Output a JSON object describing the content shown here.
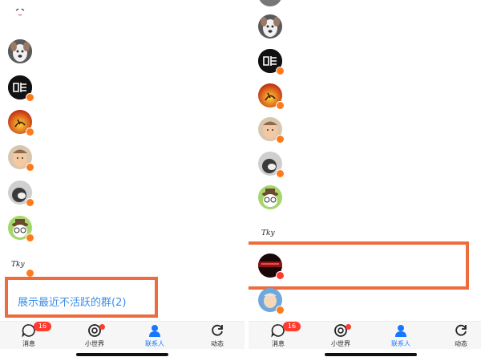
{
  "left_panel": {
    "inactive_groups_link": "展示最近不活跃的群(2)"
  },
  "tabs": [
    {
      "label": "消息",
      "badge": "16",
      "icon": "message-icon"
    },
    {
      "label": "小世界",
      "dot": true,
      "icon": "small-world-icon"
    },
    {
      "label": "联系人",
      "active": true,
      "icon": "contacts-icon"
    },
    {
      "label": "动态",
      "icon": "refresh-icon"
    }
  ],
  "colors": {
    "highlight": "#ed6c3e",
    "accent_blue": "#1677ff",
    "badge_red": "#ff3b30",
    "online_badge": "#ff7a1a"
  }
}
